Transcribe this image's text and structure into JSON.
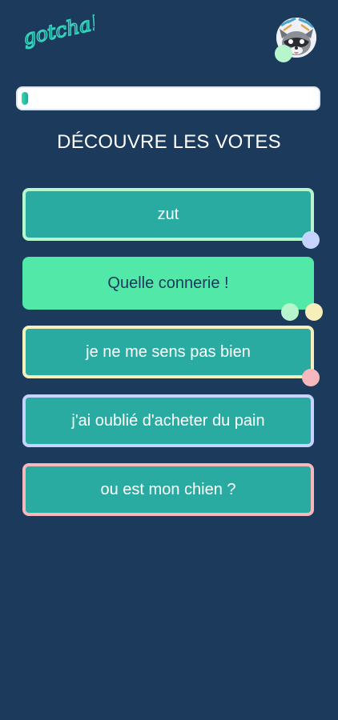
{
  "app": {
    "logo_text": "gotcha!"
  },
  "colors": {
    "background": "#1b3a5c",
    "option_fill": "#2aaba2",
    "selected_fill": "#52e8a8",
    "selected_text": "#1b3a5c",
    "logo": "#36d3bd"
  },
  "user": {
    "avatar": "raccoon-avatar",
    "dot_color": "#b7f5cd"
  },
  "progress": {
    "fraction": 0.02
  },
  "page": {
    "title": "DÉCOUVRE LES VOTES"
  },
  "options": [
    {
      "label": "zut",
      "border_color": "#b7f5cd",
      "selected": false,
      "votes": [
        "#c7d3ff"
      ]
    },
    {
      "label": "Quelle connerie !",
      "border_color": "",
      "selected": true,
      "votes": [
        "#b7f5cd",
        "#f7efb9"
      ]
    },
    {
      "label": "je ne me sens pas bien",
      "border_color": "#f7efb9",
      "selected": false,
      "votes": [
        "#f7b8bd"
      ]
    },
    {
      "label": "j'ai oublié d'acheter du pain",
      "border_color": "#c7d3ff",
      "selected": false,
      "votes": []
    },
    {
      "label": "ou est mon chien ?",
      "border_color": "#f7b8bd",
      "selected": false,
      "votes": []
    }
  ]
}
